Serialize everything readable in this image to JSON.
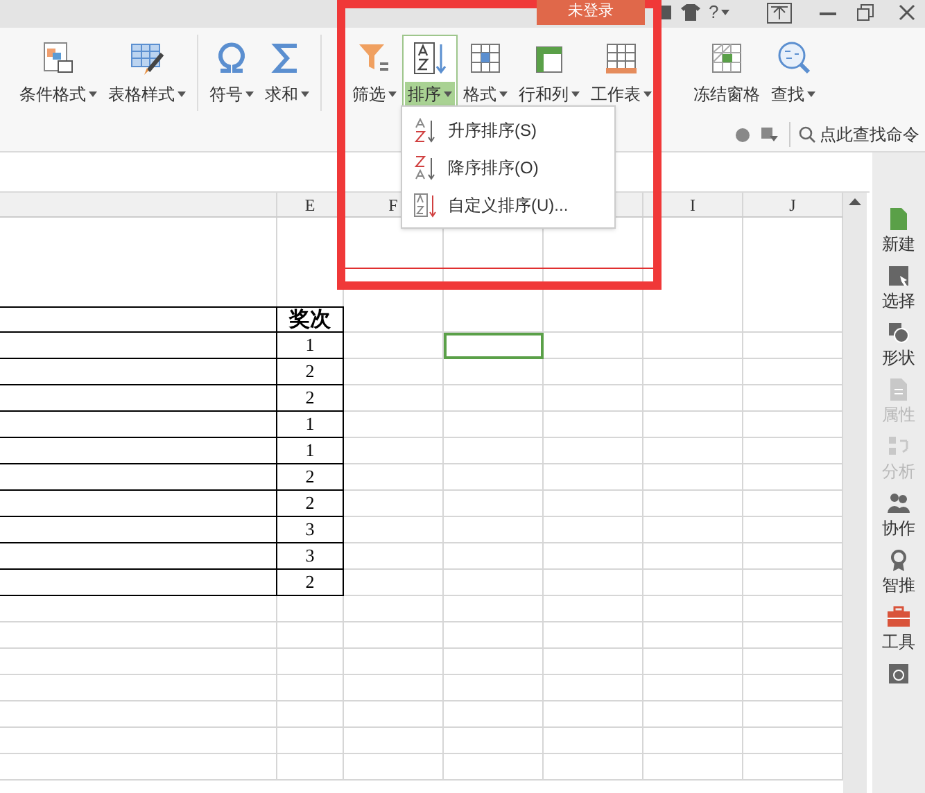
{
  "title_bar": {
    "login_button": "未登录",
    "help": "?"
  },
  "ribbon": {
    "buttons": [
      {
        "kind": "condformat",
        "label": "条件格式",
        "dropdown": true,
        "selected": false
      },
      {
        "kind": "tablestyle",
        "label": "表格样式",
        "dropdown": true,
        "selected": false
      },
      {
        "kind": "omega",
        "label": "符号",
        "dropdown": true,
        "selected": false
      },
      {
        "kind": "sigma",
        "label": "求和",
        "dropdown": true,
        "selected": false
      },
      {
        "kind": "filter",
        "label": "筛选",
        "dropdown": true,
        "selected": false
      },
      {
        "kind": "sort",
        "label": "排序",
        "dropdown": true,
        "selected": true
      },
      {
        "kind": "format",
        "label": "格式",
        "dropdown": true,
        "selected": false
      },
      {
        "kind": "rowcol",
        "label": "行和列",
        "dropdown": true,
        "selected": false
      },
      {
        "kind": "sheet",
        "label": "工作表",
        "dropdown": true,
        "selected": false
      },
      {
        "kind": "freeze",
        "label": "冻结窗格",
        "dropdown": false,
        "selected": false
      },
      {
        "kind": "find",
        "label": "查找",
        "dropdown": true,
        "selected": false
      }
    ],
    "command_search": {
      "placeholder": "点此查找命令"
    }
  },
  "sort_menu": {
    "items": [
      {
        "kind": "asc",
        "label": "升序排序(S)"
      },
      {
        "kind": "desc",
        "label": "降序排序(O)"
      },
      {
        "kind": "custom",
        "label": "自定义排序(U)..."
      }
    ]
  },
  "sheet": {
    "columns": [
      null,
      "E",
      "F",
      null,
      null,
      "I",
      "J"
    ],
    "header": "奖次",
    "values": [
      "1",
      "2",
      "2",
      "1",
      "1",
      "2",
      "2",
      "3",
      "3",
      "2"
    ]
  },
  "side_panel": {
    "items": [
      {
        "kind": "new",
        "label": "新建",
        "disabled": false
      },
      {
        "kind": "select",
        "label": "选择",
        "disabled": false
      },
      {
        "kind": "shape",
        "label": "形状",
        "disabled": false
      },
      {
        "kind": "props",
        "label": "属性",
        "disabled": true
      },
      {
        "kind": "analyze",
        "label": "分析",
        "disabled": true
      },
      {
        "kind": "collab",
        "label": "协作",
        "disabled": false
      },
      {
        "kind": "recommend",
        "label": "智推",
        "disabled": false
      },
      {
        "kind": "tools",
        "label": "工具",
        "disabled": false
      },
      {
        "kind": "backup",
        "disabled": false
      }
    ]
  }
}
